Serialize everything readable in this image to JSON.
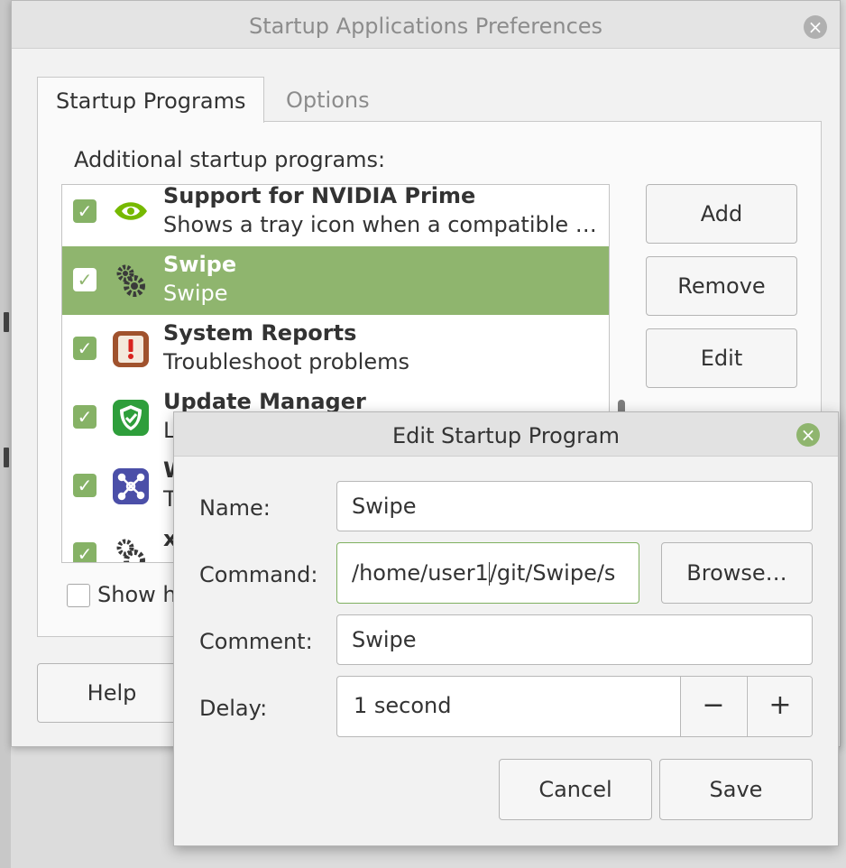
{
  "window": {
    "title": "Startup Applications Preferences"
  },
  "tabs": [
    {
      "label": "Startup Programs"
    },
    {
      "label": "Options"
    }
  ],
  "startup": {
    "section_label": "Additional startup programs:",
    "items": [
      {
        "name": "Support for NVIDIA Prime",
        "desc": "Shows a tray icon when a compatible …",
        "checked": true,
        "icon": "nvidia-icon"
      },
      {
        "name": "Swipe",
        "desc": "Swipe",
        "checked": true,
        "selected": true,
        "icon": "gears-icon"
      },
      {
        "name": "System Reports",
        "desc": "Troubleshoot problems",
        "checked": true,
        "icon": "system-reports-icon"
      },
      {
        "name": "Update Manager",
        "desc": "L",
        "checked": true,
        "icon": "shield-icon"
      },
      {
        "name": "W",
        "desc": "T",
        "checked": true,
        "icon": "network-icon"
      },
      {
        "name": "x",
        "desc": "",
        "checked": true,
        "icon": "gears-icon"
      }
    ],
    "add_label": "Add",
    "remove_label": "Remove",
    "edit_label": "Edit",
    "show_hidden_label": "Show h",
    "help_label": "Help"
  },
  "dialog": {
    "title": "Edit Startup Program",
    "name_label": "Name:",
    "name_value": "Swipe",
    "command_label": "Command:",
    "command_value_before": "/home/user1",
    "command_value_after": "/git/Swipe/s",
    "browse_label": "Browse…",
    "comment_label": "Comment:",
    "comment_value": "Swipe",
    "delay_label": "Delay:",
    "delay_value": "1 second",
    "minus_label": "−",
    "plus_label": "+",
    "cancel_label": "Cancel",
    "save_label": "Save"
  },
  "colors": {
    "accent": "#8fb56e",
    "check": "#86b266"
  }
}
